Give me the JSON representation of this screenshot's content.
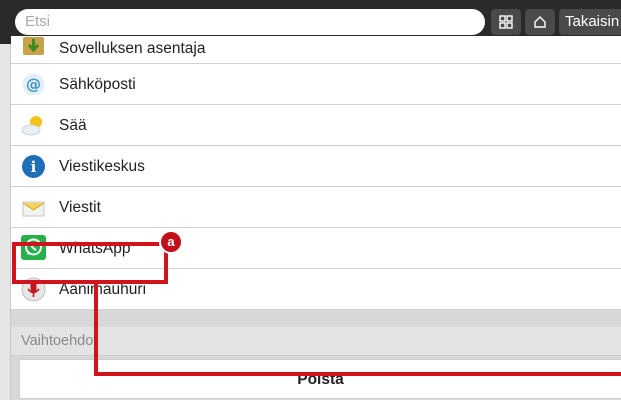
{
  "topbar": {
    "search_placeholder": "Etsi",
    "grid_icon": "grid-icon",
    "home_icon": "home-icon",
    "back_label": "Takaisin"
  },
  "apps": [
    {
      "label": "Sovelluksen asentaja",
      "icon": "installer-icon"
    },
    {
      "label": "Sähköposti",
      "icon": "email-icon"
    },
    {
      "label": "Sää",
      "icon": "weather-icon"
    },
    {
      "label": "Viestikeskus",
      "icon": "message-center-icon"
    },
    {
      "label": "Viestit",
      "icon": "messages-icon"
    },
    {
      "label": "WhatsApp",
      "icon": "whatsapp-icon"
    },
    {
      "label": "Äänimauhuri",
      "icon": "voice-recorder-icon"
    }
  ],
  "options": {
    "header": "Vaihtoehdot",
    "delete_label": "Poista"
  },
  "callout": {
    "badge": "a",
    "color": "#d0141e"
  },
  "colors": {
    "topbar": "#2a2a2a",
    "whatsapp_green": "#25b04a"
  }
}
